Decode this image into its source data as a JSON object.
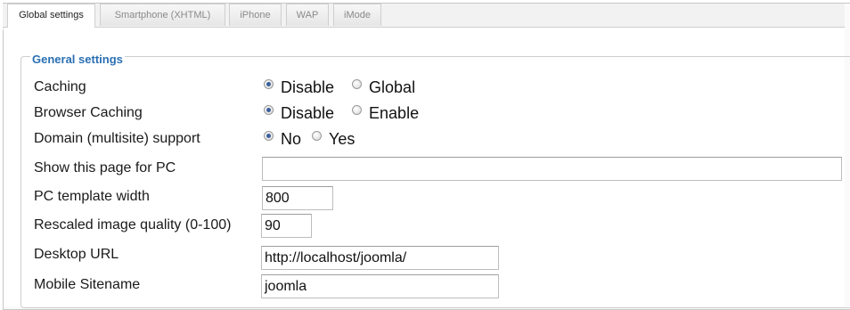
{
  "tabs": [
    {
      "label": "Global settings",
      "active": true
    },
    {
      "label": "Smartphone (XHTML)",
      "active": false
    },
    {
      "label": "iPhone",
      "active": false
    },
    {
      "label": "WAP",
      "active": false
    },
    {
      "label": "iMode",
      "active": false
    }
  ],
  "section": {
    "title": "General settings"
  },
  "settings": {
    "caching": {
      "label": "Caching",
      "options": [
        "Disable",
        "Global"
      ],
      "selected": "Disable"
    },
    "browser_caching": {
      "label": "Browser Caching",
      "options": [
        "Disable",
        "Enable"
      ],
      "selected": "Disable"
    },
    "domain_support": {
      "label": "Domain (multisite) support",
      "options": [
        "No",
        "Yes"
      ],
      "selected": "No"
    },
    "pc_page": {
      "label": "Show this page for PC",
      "value": ""
    },
    "pc_template_width": {
      "label": "PC template width",
      "value": "800"
    },
    "image_quality": {
      "label": "Rescaled image quality (0-100)",
      "value": "90"
    },
    "desktop_url": {
      "label": "Desktop URL",
      "value": "http://localhost/joomla/"
    },
    "mobile_sitename": {
      "label": "Mobile Sitename",
      "value": "joomla"
    }
  },
  "colors": {
    "legend": "#2a6fb3",
    "border": "#cfcfcf",
    "radio_checked": "#3a5f9a"
  }
}
